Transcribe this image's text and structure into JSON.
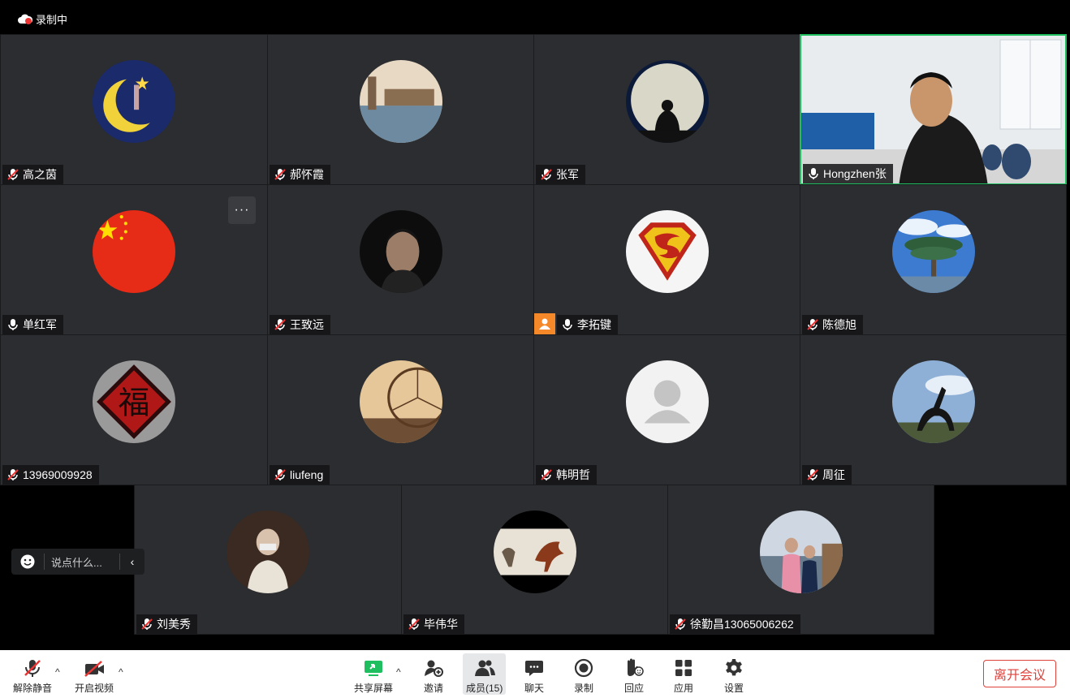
{
  "recording": {
    "label": "录制中"
  },
  "participants": [
    {
      "name": "高之茵"
    },
    {
      "name": "郝怀霞"
    },
    {
      "name": "张军"
    },
    {
      "name": "Hongzhen张"
    },
    {
      "name": "单红军"
    },
    {
      "name": "王致远"
    },
    {
      "name": "李拓键"
    },
    {
      "name": "陈德旭"
    },
    {
      "name": "13969009928"
    },
    {
      "name": "liufeng"
    },
    {
      "name": "韩明哲"
    },
    {
      "name": "周征"
    },
    {
      "name": "刘美秀"
    },
    {
      "name": "毕伟华"
    },
    {
      "name": "徐勤昌13065006262"
    }
  ],
  "tile_menu": {
    "label": "···"
  },
  "chat": {
    "placeholder": "说点什么...",
    "collapse": "‹"
  },
  "toolbar": {
    "unmute": "解除静音",
    "start_video": "开启视频",
    "share_screen": "共享屏幕",
    "invite": "邀请",
    "members": "成员(15)",
    "chat": "聊天",
    "record": "录制",
    "reactions": "回应",
    "apps": "应用",
    "settings": "设置",
    "leave": "离开会议",
    "caret": "^"
  },
  "colors": {
    "accent_green": "#1fbf5f",
    "leave_red": "#e0413a",
    "host_orange": "#f5892a"
  }
}
